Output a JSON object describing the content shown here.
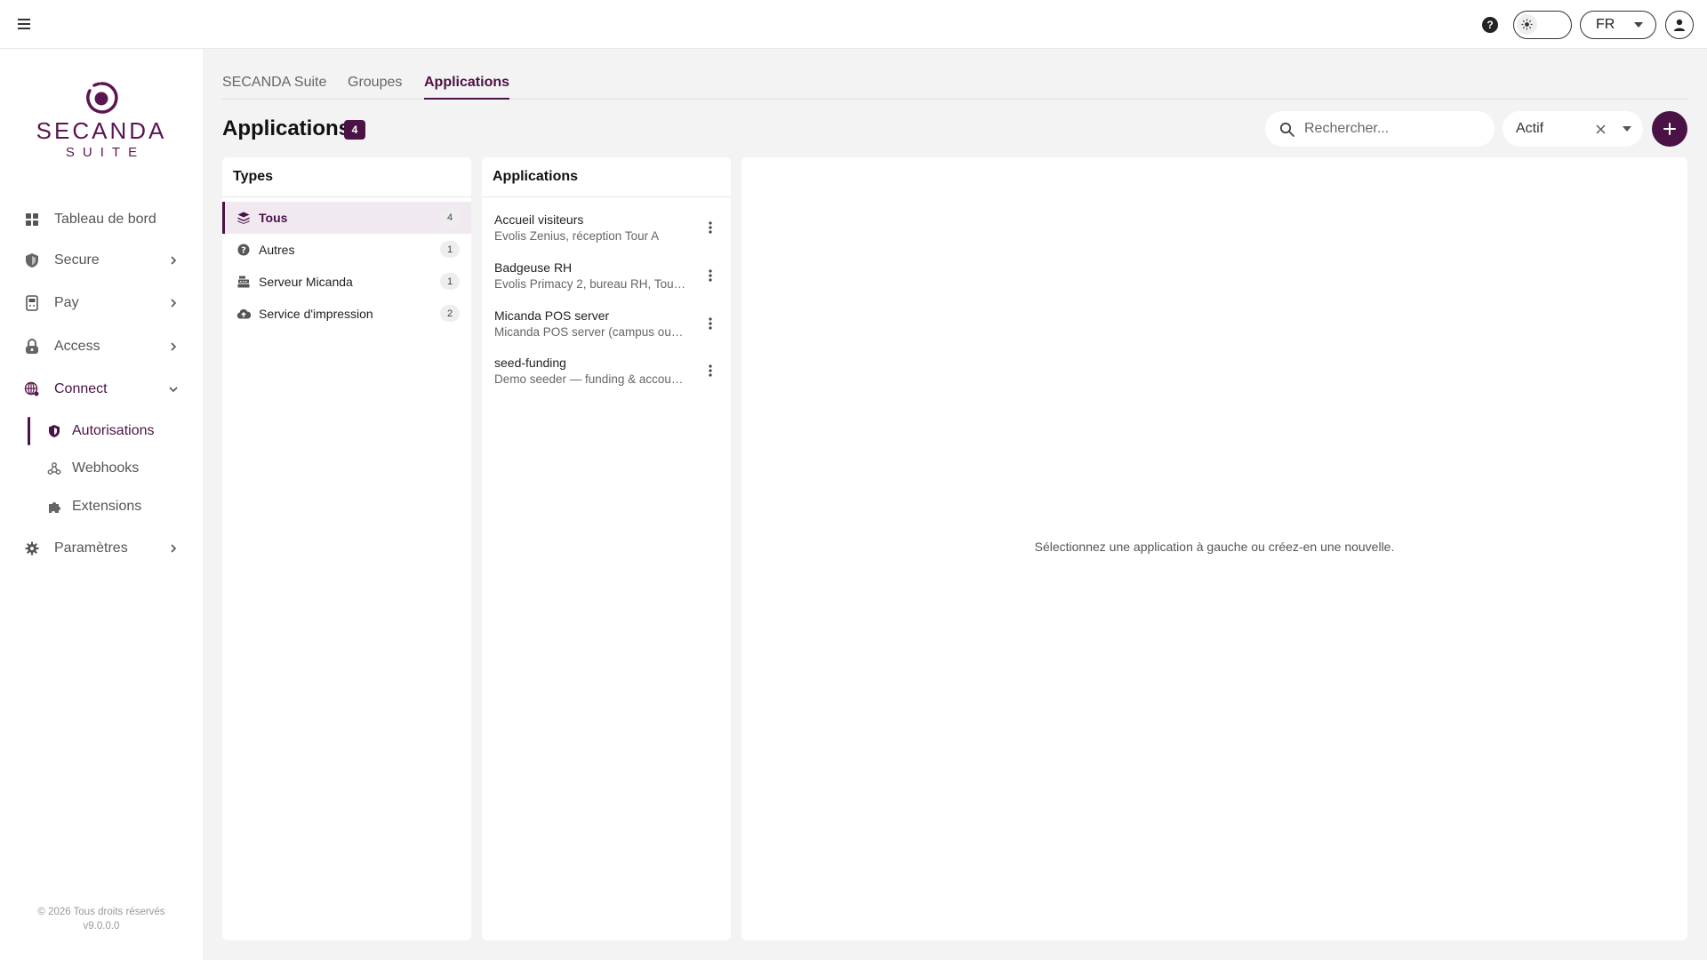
{
  "topbar": {
    "menu_icon": "hamburger-icon",
    "help_icon": "help-circle-icon",
    "help_glyph": "?",
    "theme_icon": "sun-icon",
    "language": "FR",
    "user_icon": "user-account-icon"
  },
  "brand": {
    "name": "SECANDA",
    "sub": "SUITE",
    "color": "#5b1650"
  },
  "sidebar": {
    "items": [
      {
        "label": "Tableau de bord",
        "icon": "dashboard-grid-icon"
      },
      {
        "label": "Secure",
        "icon": "shield-icon"
      },
      {
        "label": "Pay",
        "icon": "payment-terminal-icon"
      },
      {
        "label": "Access",
        "icon": "lock-icon"
      },
      {
        "label": "Connect",
        "icon": "globe-network-icon",
        "expanded": true
      },
      {
        "label": "Paramètres",
        "icon": "gear-icon"
      }
    ],
    "connect_sub": [
      {
        "label": "Autorisations",
        "icon": "shield-half-icon",
        "active": true
      },
      {
        "label": "Webhooks",
        "icon": "webhook-icon"
      },
      {
        "label": "Extensions",
        "icon": "puzzle-icon"
      }
    ],
    "footer": {
      "copyright": "© 2026 Tous droits réservés",
      "version": "v9.0.0.0"
    }
  },
  "tabs": [
    {
      "label": "SECANDA Suite"
    },
    {
      "label": "Groupes"
    },
    {
      "label": "Applications",
      "active": true
    }
  ],
  "page": {
    "title": "Applications",
    "count": "4"
  },
  "search": {
    "placeholder": "Rechercher...",
    "value": ""
  },
  "status_filter": {
    "value": "Actif"
  },
  "accent_color": "#4a1245",
  "types_panel": {
    "title": "Types",
    "items": [
      {
        "label": "Tous",
        "count": "4",
        "icon": "layers-icon",
        "active": true
      },
      {
        "label": "Autres",
        "count": "1",
        "icon": "question-circle-icon"
      },
      {
        "label": "Serveur Micanda",
        "count": "1",
        "icon": "cash-register-icon"
      },
      {
        "label": "Service d'impression",
        "count": "2",
        "icon": "cloud-upload-icon"
      }
    ]
  },
  "apps_panel": {
    "title": "Applications",
    "items": [
      {
        "name": "Accueil visiteurs",
        "desc": "Evolis Zenius, réception Tour A"
      },
      {
        "name": "Badgeuse RH",
        "desc": "Evolis Primacy 2, bureau RH, Tour…"
      },
      {
        "name": "Micanda POS server",
        "desc": "Micanda POS server (campus ou…"
      },
      {
        "name": "seed-funding",
        "desc": "Demo seeder — funding & accou…"
      }
    ]
  },
  "detail_panel": {
    "empty_message": "Sélectionnez une application à gauche ou créez-en une nouvelle."
  }
}
